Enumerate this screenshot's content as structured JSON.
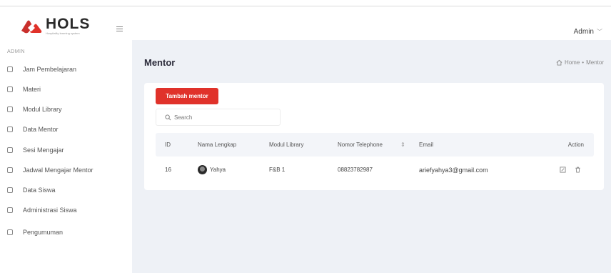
{
  "header": {
    "logo_text": "HOLS",
    "logo_tagline": "Hospitality learning system",
    "admin_label": "Admin"
  },
  "sidebar": {
    "heading": "ADMIN",
    "items": [
      {
        "label": "Jam Pembelajaran"
      },
      {
        "label": "Materi"
      },
      {
        "label": "Modul Library"
      },
      {
        "label": "Data Mentor"
      },
      {
        "label": "Sesi Mengajar"
      },
      {
        "label": "Jadwal Mengajar Mentor"
      },
      {
        "label": "Data Siswa"
      },
      {
        "label": "Administrasi Siswa"
      },
      {
        "label": "Pengumuman"
      }
    ]
  },
  "main": {
    "title": "Mentor",
    "breadcrumb": {
      "home": "Home",
      "separator": "•",
      "current": "Mentor"
    },
    "add_button": "Tambah mentor",
    "search_placeholder": "Search",
    "table": {
      "columns": [
        "ID",
        "Nama Lengkap",
        "Modul Library",
        "Nomor Telephone",
        "Email",
        "Action"
      ],
      "rows": [
        {
          "id": "16",
          "name": "Yahya",
          "modul": "F&B 1",
          "phone": "08823782987",
          "email": "ariefyahya3@gmail.com"
        }
      ]
    }
  },
  "colors": {
    "brand_red": "#e0322a",
    "background": "#eef1f6",
    "table_header": "#f3f5f9"
  },
  "icons": {
    "logo": "hols-logo-icon",
    "menu": "hamburger-icon",
    "home": "home-icon",
    "search": "search-icon",
    "sort": "sort-icon",
    "edit": "edit-icon",
    "delete": "trash-icon"
  }
}
